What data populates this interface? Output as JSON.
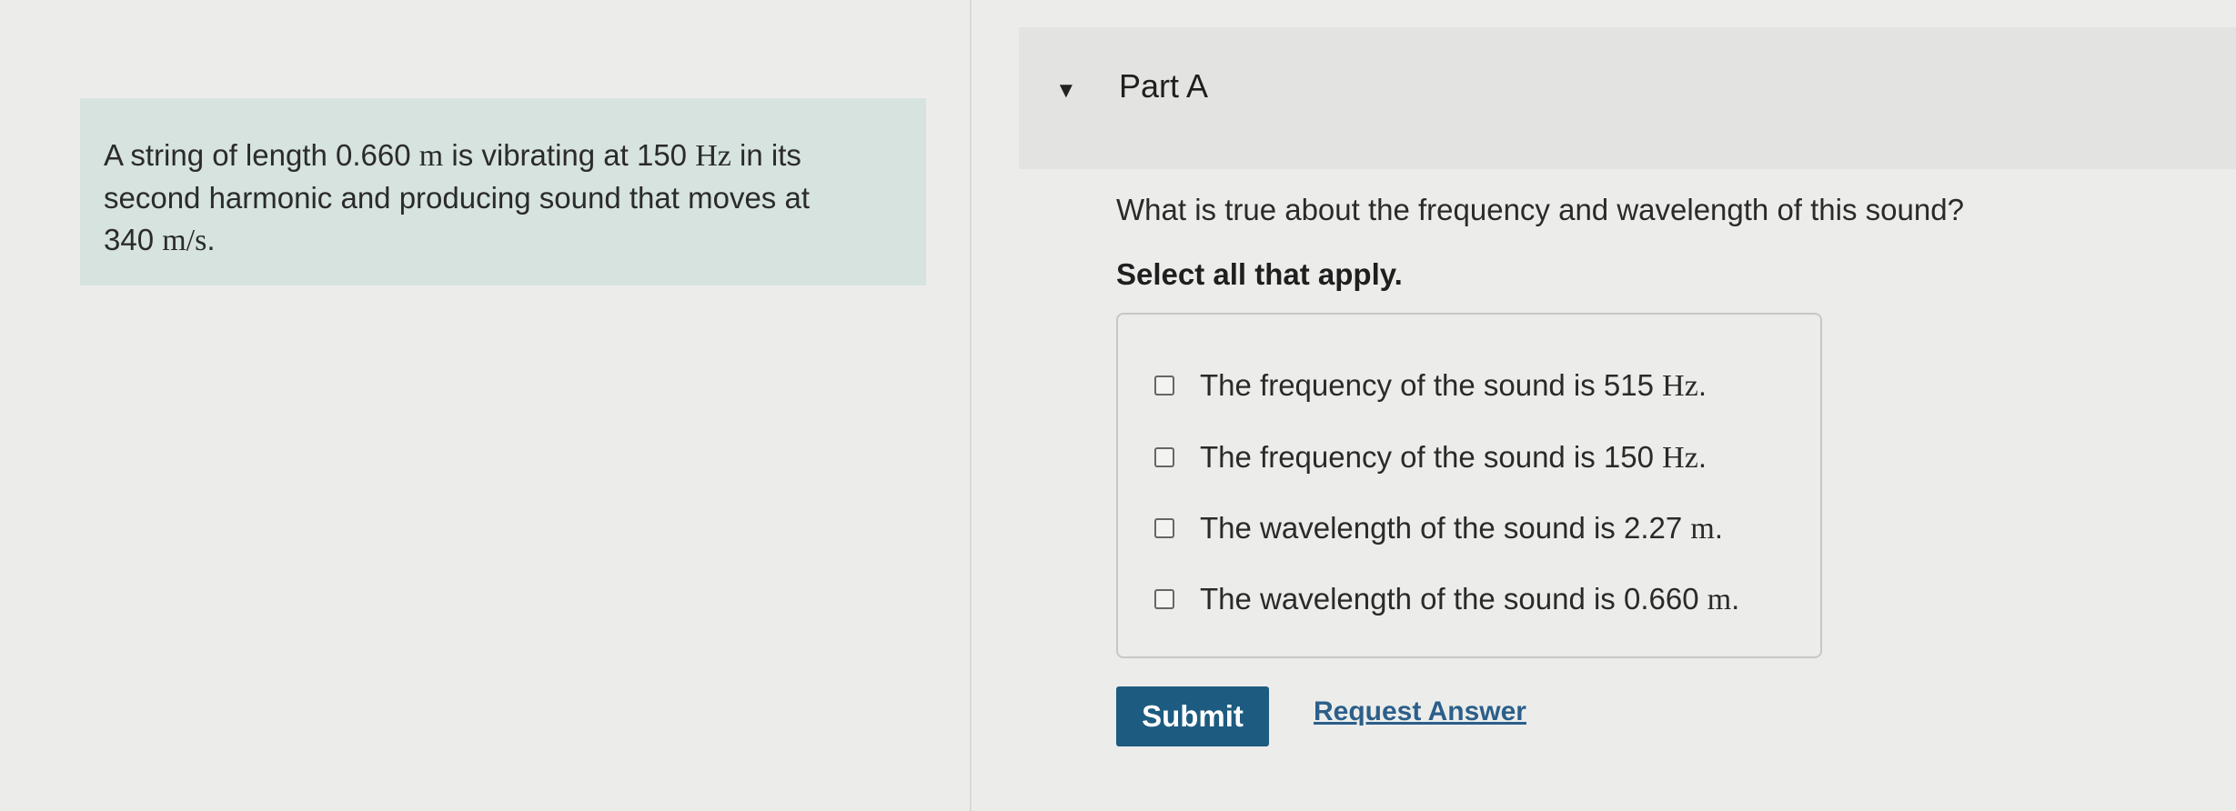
{
  "problem": {
    "t1": "A string of length 0.660 ",
    "m1": "m",
    "t2": " is vibrating at 150 ",
    "m2": "Hz",
    "t3": " in its second harmonic and producing sound that moves at ",
    "t4": "340 ",
    "m3": "m/s",
    "t5": "."
  },
  "part": {
    "title": "Part A",
    "caret_icon": "caret-down-icon"
  },
  "question": "What is true about the frequency and wavelength of this sound?",
  "instruction": "Select all that apply.",
  "options": [
    {
      "text": "The frequency of the sound is 515 ",
      "unit": "Hz",
      "end": ".",
      "checked": false
    },
    {
      "text": "The frequency of the sound is 150 ",
      "unit": "Hz",
      "end": ".",
      "checked": false
    },
    {
      "text": "The wavelength of the sound is 2.27 ",
      "unit": "m",
      "end": ".",
      "checked": false
    },
    {
      "text": "The wavelength of the sound is 0.660 ",
      "unit": "m",
      "end": ".",
      "checked": false
    }
  ],
  "actions": {
    "submit_label": "Submit",
    "request_label": "Request Answer"
  },
  "colors": {
    "submit_bg": "#1d5b80",
    "link": "#2c5f8a",
    "problem_panel": "#d6e3df"
  }
}
